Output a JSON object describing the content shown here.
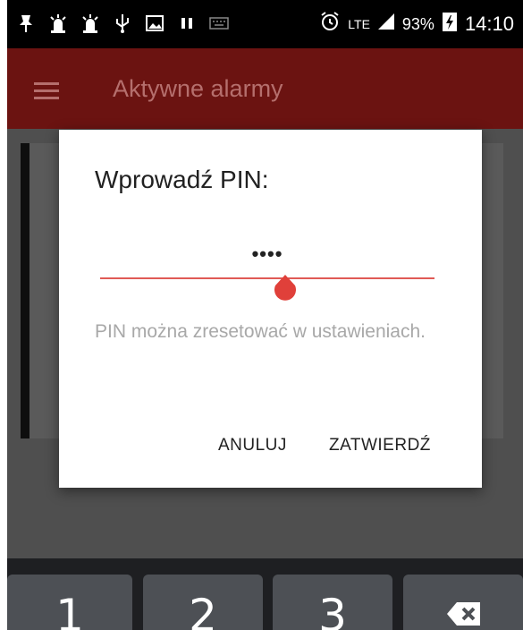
{
  "status_bar": {
    "left_icons": [
      "pin-icon",
      "siren-icon",
      "siren-icon",
      "usb-icon",
      "image-icon",
      "pause-icon",
      "keyboard-icon"
    ],
    "alarm_icon": "alarm-clock-icon",
    "network": "LTE",
    "battery_percent": "93%",
    "time": "14:10"
  },
  "app_bar": {
    "menu_icon": "hamburger-icon",
    "title": "Aktywne alarmy"
  },
  "dialog": {
    "title": "Wprowadź PIN:",
    "pin_value": "••••",
    "helper_text": "PIN można zresetować w ustawieniach.",
    "cancel_label": "ANULUJ",
    "confirm_label": "ZATWIERDŹ"
  },
  "keyboard": {
    "keys": [
      "1",
      "2",
      "3"
    ],
    "delete_icon": "backspace-icon"
  },
  "colors": {
    "app_bar": "#6b1311",
    "accent": "#e05a55",
    "dialog_bg": "#ffffff"
  }
}
